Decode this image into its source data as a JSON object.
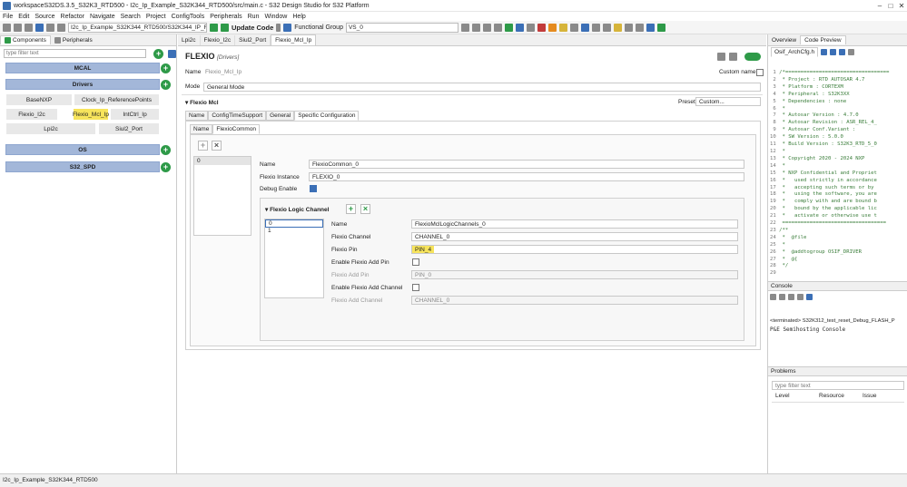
{
  "window": {
    "title": "workspaceS32DS.3.5_S32K3_RTD500 - I2c_Ip_Example_S32K344_RTD500/src/main.c - S32 Design Studio for S32 Platform"
  },
  "menu": [
    "File",
    "Edit",
    "Source",
    "Refactor",
    "Navigate",
    "Search",
    "Project",
    "ConfigTools",
    "Peripherals",
    "Run",
    "Window",
    "Help"
  ],
  "toolbar": {
    "project_combo": "I2c_Ip_Example_S32K344_RTD500/S32K344_IP_Flexic",
    "update_code": "Update Code",
    "functional_group_label": "Functional Group",
    "functional_group_value": "VS_0"
  },
  "left": {
    "tabs": [
      "Components",
      "Peripherals"
    ],
    "filter_placeholder": "type filter text",
    "groups": {
      "mcal": "MCAL",
      "drivers": "Drivers",
      "os": "OS",
      "s32_spd": "S32_SPD"
    },
    "components": [
      "BaseNXP",
      "Clock_Ip_ReferencePoints",
      "Flexio_I2c",
      "Flexio_Mcl_Ip",
      "IntCtrl_Ip",
      "Lpi2c",
      "Siul2_Port"
    ]
  },
  "editor": {
    "tabs": [
      "Lpi2c",
      "Flexio_I2c",
      "Siul2_Port",
      "Flexio_Mcl_Ip"
    ],
    "heading": "FLEXIO",
    "heading_sub": "[Drivers]",
    "name_label": "Name",
    "name_value": "Flexio_Mcl_Ip",
    "custom_name": "Custom name",
    "mode_label": "Mode",
    "mode_value": "General Mode",
    "section": "Flexio Mcl",
    "preset_label": "Preset",
    "preset_value": "Custom...",
    "config_tabs": [
      "Name",
      "ConfigTimeSupport",
      "General",
      "Specific Configuration"
    ],
    "inner_tabs": [
      "Name",
      "FlexioCommon"
    ],
    "common_list": [
      "0"
    ],
    "common": {
      "name_label": "Name",
      "name_value": "FlexioCommon_0",
      "instance_label": "Flexio Instance",
      "instance_value": "FLEXIO_0",
      "debug_label": "Debug Enable"
    },
    "logic_channel": {
      "title": "Flexio Logic Channel",
      "list": [
        "0",
        "1"
      ],
      "name_label": "Name",
      "name_value": "FlexioMclLogicChannels_0",
      "channel_label": "Flexio Channel",
      "channel_value": "CHANNEL_0",
      "pin_label": "Flexio Pin",
      "pin_value": "PIN_4",
      "add_pin_en_label": "Enable Flexio Add Pin",
      "add_pin_label": "Flexio Add Pin",
      "add_pin_value": "PIN_0",
      "add_ch_en_label": "Enable Flexio Add Channel",
      "add_ch_label": "Flexio Add Channel",
      "add_ch_value": "CHANNEL_0"
    }
  },
  "right": {
    "tabs": [
      "Overview",
      "Code Preview"
    ],
    "file_tab": "Osif_ArchCfg.h",
    "code_lines": [
      "/*==================================",
      " * Project : RTD AUTOSAR 4.7",
      " * Platform : CORTEXM",
      " * Peripheral : S32K3XX",
      " * Dependencies : none",
      " *",
      " * Autosar Version : 4.7.0",
      " * Autosar Revision : ASR_REL_4_",
      " * Autosar Conf.Variant :",
      " * SW Version : 5.0.0",
      " * Build Version : S32K3_RTD_5_0",
      " *",
      " * Copyright 2020 - 2024 NXP",
      " *",
      " * NXP Confidential and Propriet",
      " *   used strictly in accordance",
      " *   accepting such terms or by",
      " *   using the software, you are",
      " *   comply with and are bound b",
      " *   bound by the applicable lic",
      " *   activate or otherwise use t",
      " ==================================",
      "/**",
      " *  @file",
      " *",
      " *  @addtogroup OSIF_DRIVER",
      " *  @{",
      " */",
      ""
    ],
    "console_tab": "Console",
    "console_terminated": "<terminated> S32K312_test_reset_Debug_FLASH_P",
    "console_text": "P&E Semihosting Console",
    "problems_tab": "Problems",
    "problems_filter": "type filter text",
    "problems_cols": [
      "Level",
      "Resource",
      "Issue"
    ]
  },
  "status": {
    "text": "I2c_Ip_Example_S32K344_RTD500"
  }
}
